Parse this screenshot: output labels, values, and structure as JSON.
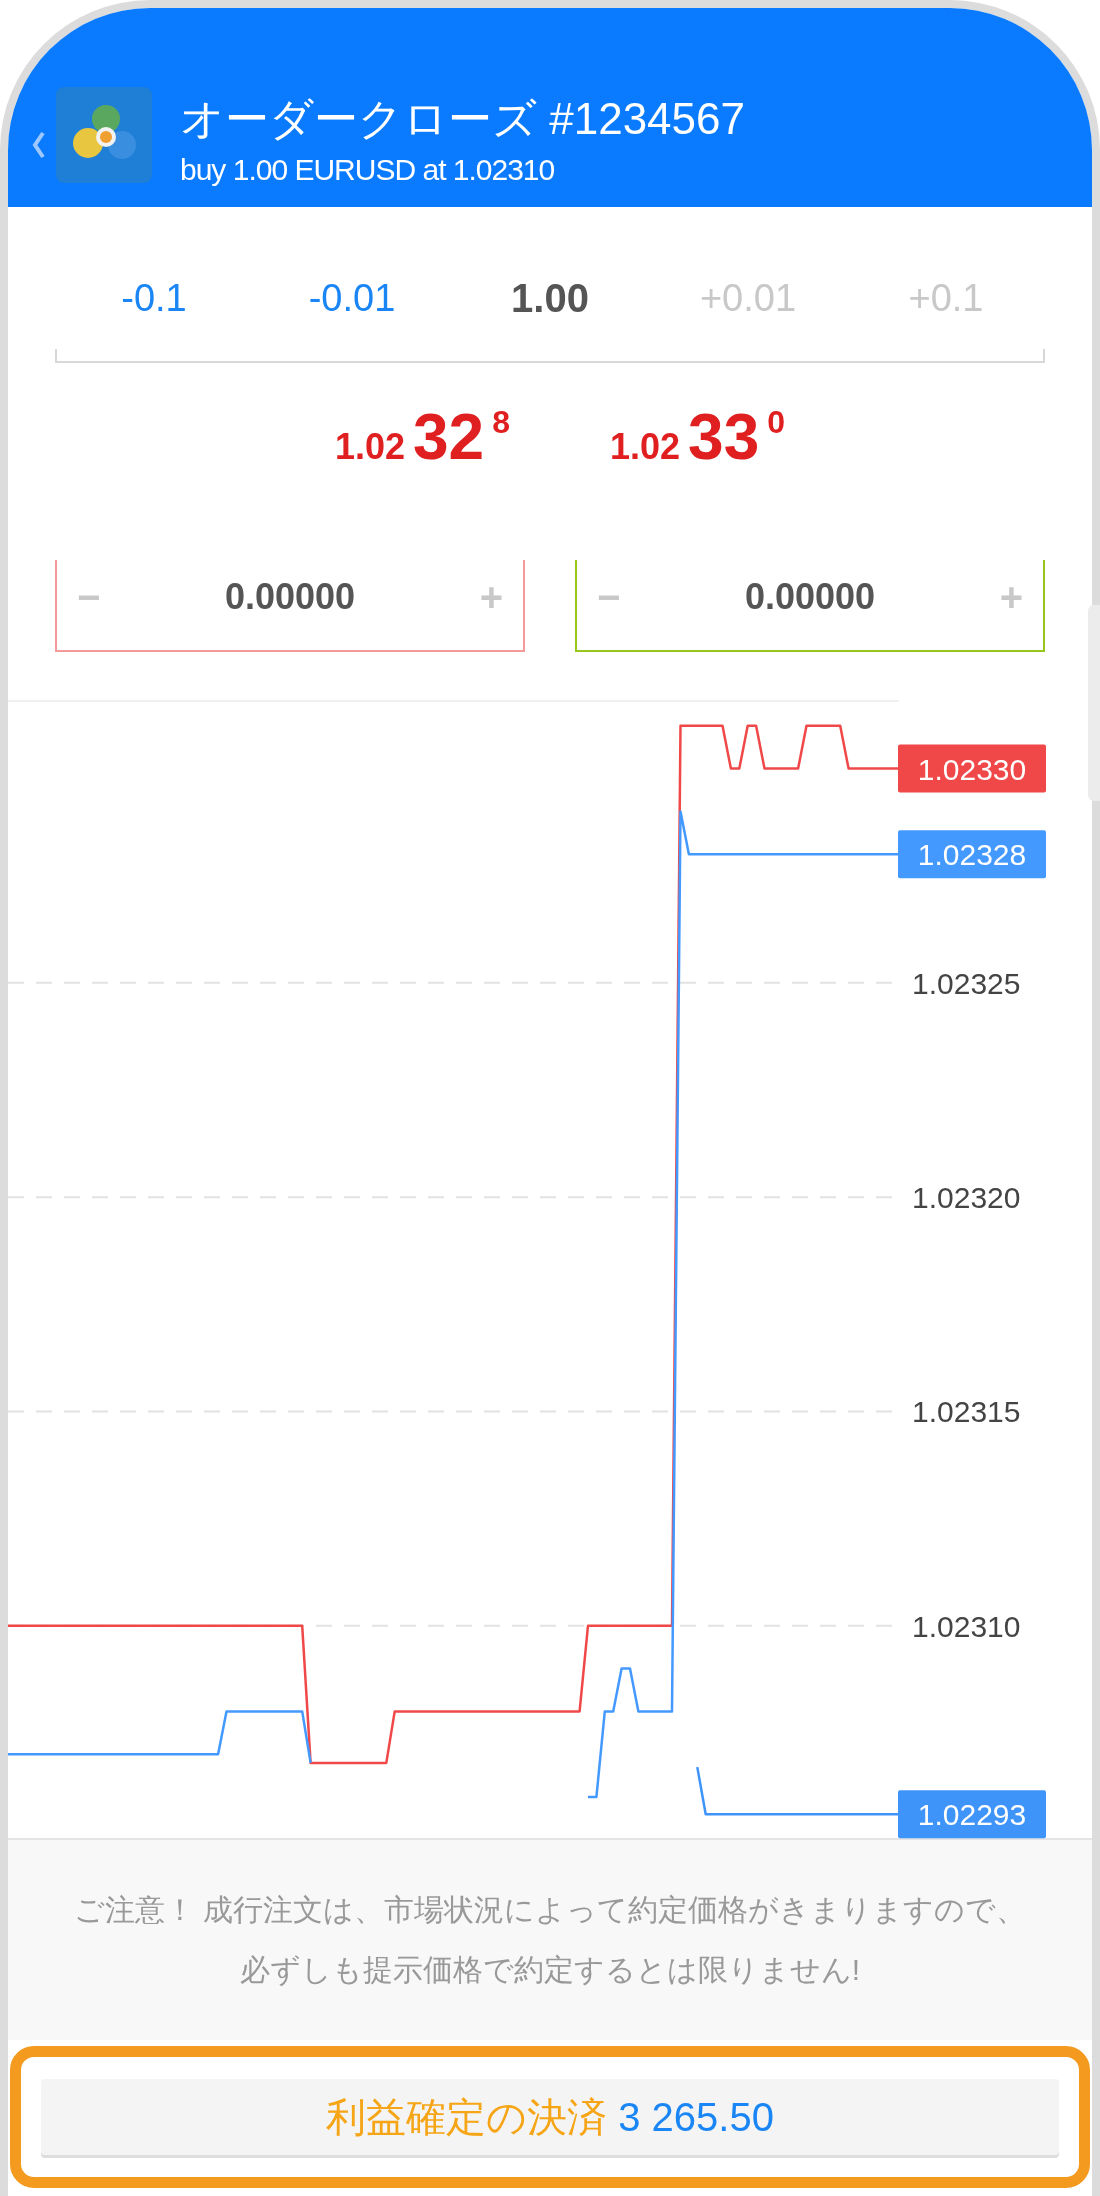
{
  "header": {
    "title": "オーダークローズ #1234567",
    "subtitle": "buy 1.00 EURUSD at 1.02310"
  },
  "volume": {
    "decrease": [
      {
        "label": "-0.1",
        "disabled": false
      },
      {
        "label": "-0.01",
        "disabled": false
      }
    ],
    "value": "1.00",
    "increase": [
      {
        "label": "+0.01",
        "disabled": true
      },
      {
        "label": "+0.1",
        "disabled": true
      }
    ]
  },
  "prices": [
    {
      "big_figure": "1.02",
      "pips": "32",
      "fraction": "8"
    },
    {
      "big_figure": "1.02",
      "pips": "33",
      "fraction": "0"
    }
  ],
  "levels": [
    {
      "kind": "stop_loss",
      "decrement": "−",
      "value": "0.00000",
      "increment": "+"
    },
    {
      "kind": "take_profit",
      "decrement": "−",
      "value": "0.00000",
      "increment": "+"
    }
  ],
  "chart_data": {
    "type": "line",
    "series": [
      {
        "color": "#f04848",
        "values": [
          1.0231,
          1.0231,
          1.0231,
          1.0231,
          1.0231,
          1.0231,
          1.0231,
          1.0231,
          1.0231,
          1.0231,
          1.0231,
          1.0231,
          1.0231,
          1.0231,
          1.0231,
          1.0231,
          1.0231,
          1.0231,
          1.0231,
          1.0231,
          1.0231,
          1.0231,
          1.0231,
          1.0231,
          1.0231,
          1.0231,
          1.0231,
          1.0231,
          1.0231,
          1.0231,
          1.0231,
          1.0231,
          1.0231,
          1.0231,
          1.0231,
          1.0231,
          1.023068,
          1.023068,
          1.023068,
          1.023068,
          1.023068,
          1.023068,
          1.023068,
          1.023068,
          1.023068,
          1.023068,
          1.02308,
          1.02308,
          1.02308,
          1.02308,
          1.02308,
          1.02308,
          1.02308,
          1.02308,
          1.02308,
          1.02308,
          1.02308,
          1.02308,
          1.02308,
          1.02308,
          1.02308,
          1.02308,
          1.02308,
          1.02308,
          1.02308,
          1.02308,
          1.02308,
          1.02308,
          1.02308,
          1.0231,
          1.0231,
          1.0231,
          1.0231,
          1.0231,
          1.0231,
          1.0231,
          1.0231,
          1.0231,
          1.0231,
          1.0231,
          1.02331,
          1.02331,
          1.02331,
          1.02331,
          1.02331,
          1.02331,
          1.0233,
          1.0233,
          1.02331,
          1.02331,
          1.0233,
          1.0233,
          1.0233,
          1.0233,
          1.0233,
          1.02331,
          1.02331,
          1.02331,
          1.02331,
          1.02331,
          1.0233,
          1.0233,
          1.0233,
          1.0233,
          1.0233,
          1.0233,
          1.0233
        ]
      },
      {
        "color": "#4499ff",
        "values": [
          1.02307,
          1.02307,
          1.02307,
          1.02307,
          1.02307,
          1.02307,
          1.02307,
          1.02307,
          1.02307,
          1.02307,
          1.02307,
          1.02307,
          1.02307,
          1.02307,
          1.02307,
          1.02307,
          1.02307,
          1.02307,
          1.02307,
          1.02307,
          1.02307,
          1.02307,
          1.02307,
          1.02307,
          1.02307,
          1.02307,
          1.02308,
          1.02308,
          1.02308,
          1.02308,
          1.02308,
          1.02308,
          1.02308,
          1.02308,
          1.02308,
          1.02308,
          1.023068,
          null,
          null,
          null,
          null,
          null,
          null,
          null,
          null,
          null,
          null,
          null,
          null,
          null,
          null,
          null,
          null,
          null,
          null,
          null,
          null,
          null,
          null,
          null,
          null,
          null,
          null,
          null,
          null,
          null,
          null,
          null,
          null,
          1.02306,
          1.02306,
          1.02308,
          1.02308,
          1.02309,
          1.02309,
          1.02308,
          1.02308,
          1.02308,
          1.02308,
          1.02308,
          1.02329,
          1.02328,
          1.02328,
          1.02328,
          1.02328,
          1.02328,
          1.02328,
          1.02328,
          1.02328,
          1.02328,
          1.02328,
          1.02328,
          1.02328,
          1.02328,
          1.02328,
          1.02328,
          1.02328,
          1.02328,
          1.02328,
          1.02328,
          1.02328,
          1.02328,
          1.02328,
          1.02328,
          1.02328,
          1.02328,
          1.02328
        ]
      },
      {
        "color": "#3f94fa",
        "values": [
          null,
          null,
          null,
          null,
          null,
          null,
          null,
          null,
          null,
          null,
          null,
          null,
          null,
          null,
          null,
          null,
          null,
          null,
          null,
          null,
          null,
          null,
          null,
          null,
          null,
          null,
          null,
          null,
          null,
          null,
          null,
          null,
          null,
          null,
          null,
          null,
          null,
          null,
          null,
          null,
          null,
          null,
          null,
          null,
          null,
          null,
          null,
          null,
          null,
          null,
          null,
          null,
          null,
          null,
          null,
          null,
          null,
          null,
          null,
          null,
          null,
          null,
          null,
          null,
          null,
          null,
          null,
          null,
          null,
          null,
          null,
          null,
          null,
          null,
          null,
          null,
          null,
          null,
          null,
          null,
          null,
          null,
          1.023067,
          1.023056,
          1.023056,
          1.023056,
          1.023056,
          1.023056,
          1.023056,
          1.023056,
          1.023056,
          1.023056,
          1.023056,
          1.023056,
          1.023056,
          1.023056,
          1.023056,
          1.023056,
          1.023056,
          1.023056,
          1.023056,
          1.023056,
          1.023056,
          1.023056,
          1.023056,
          1.023056,
          1.023056
        ]
      }
    ],
    "ylim": [
      1.02305,
      1.023316
    ],
    "grid": true,
    "yticks": [
      {
        "value": 1.02325,
        "label": "1.02325"
      },
      {
        "value": 1.0232,
        "label": "1.02320"
      },
      {
        "value": 1.02315,
        "label": "1.02315"
      },
      {
        "value": 1.0231,
        "label": "1.02310"
      }
    ],
    "annotations": [
      "1.02330",
      "1.02328",
      "1.02293"
    ]
  },
  "notice": "ご注意！ 成行注文は、市場状況によって約定価格がきまりますので、必ずしも提示価格で約定するとは限りません!",
  "close_button": {
    "label": "利益確定の決済",
    "amount": "3 265.50"
  }
}
